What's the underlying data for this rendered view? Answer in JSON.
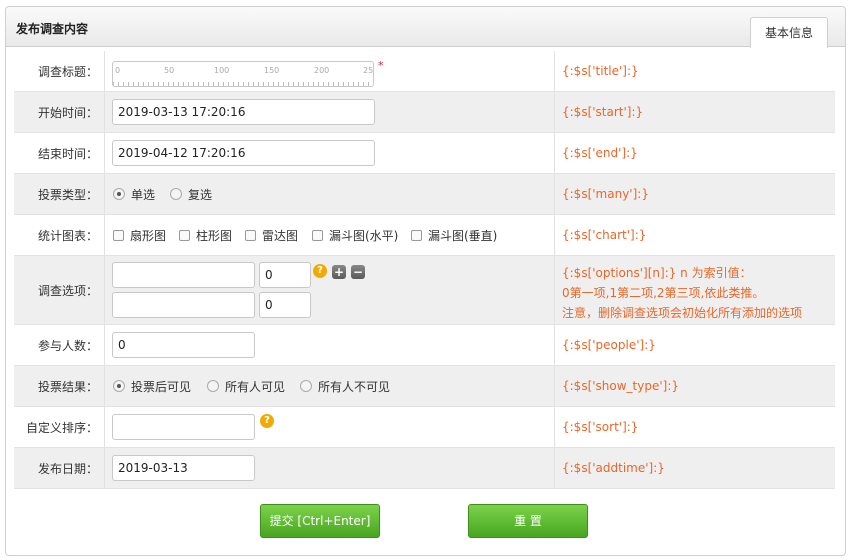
{
  "header": {
    "title": "发布调查内容",
    "tab": "基本信息"
  },
  "rows": {
    "title": {
      "label": "调查标题：",
      "ruler_ticks": [
        "0",
        "50",
        "100",
        "150",
        "200",
        "25"
      ],
      "required_mark": "*",
      "hint": "{:$s['title']:}"
    },
    "start": {
      "label": "开始时间：",
      "value": "2019-03-13 17:20:16",
      "hint": "{:$s['start']:}"
    },
    "end": {
      "label": "结束时间：",
      "value": "2019-04-12 17:20:16",
      "hint": "{:$s['end']:}"
    },
    "many": {
      "label": "投票类型：",
      "options": [
        "单选",
        "复选"
      ],
      "selected": "单选",
      "hint": "{:$s['many']:}"
    },
    "chart": {
      "label": "统计图表：",
      "options": [
        "扇形图",
        "柱形图",
        "雷达图",
        "漏斗图(水平)",
        "漏斗图(垂直)"
      ],
      "hint": "{:$s['chart']:}"
    },
    "options": {
      "label": "调查选项：",
      "items": [
        {
          "text": "",
          "count": "0"
        },
        {
          "text": "",
          "count": "0"
        }
      ],
      "hint_lines": [
        "{:$s['options'][n]:} n 为索引值：",
        "0第一项,1第二项,2第三项,依此类推。",
        "注意，删除调查选项会初始化所有添加的选项"
      ]
    },
    "people": {
      "label": "参与人数：",
      "value": "0",
      "hint": "{:$s['people']:}"
    },
    "show_type": {
      "label": "投票结果：",
      "options": [
        "投票后可见",
        "所有人可见",
        "所有人不可见"
      ],
      "selected": "投票后可见",
      "hint": "{:$s['show_type']:}"
    },
    "sort": {
      "label": "自定义排序：",
      "value": "",
      "hint": "{:$s['sort']:}"
    },
    "addtime": {
      "label": "发布日期：",
      "value": "2019-03-13",
      "hint": "{:$s['addtime']:}"
    }
  },
  "buttons": {
    "submit": "提交 [Ctrl+Enter]",
    "reset": "重 置"
  },
  "colors": {
    "hint": "#e8672a",
    "button": "#5db531",
    "required": "#dd2222"
  }
}
